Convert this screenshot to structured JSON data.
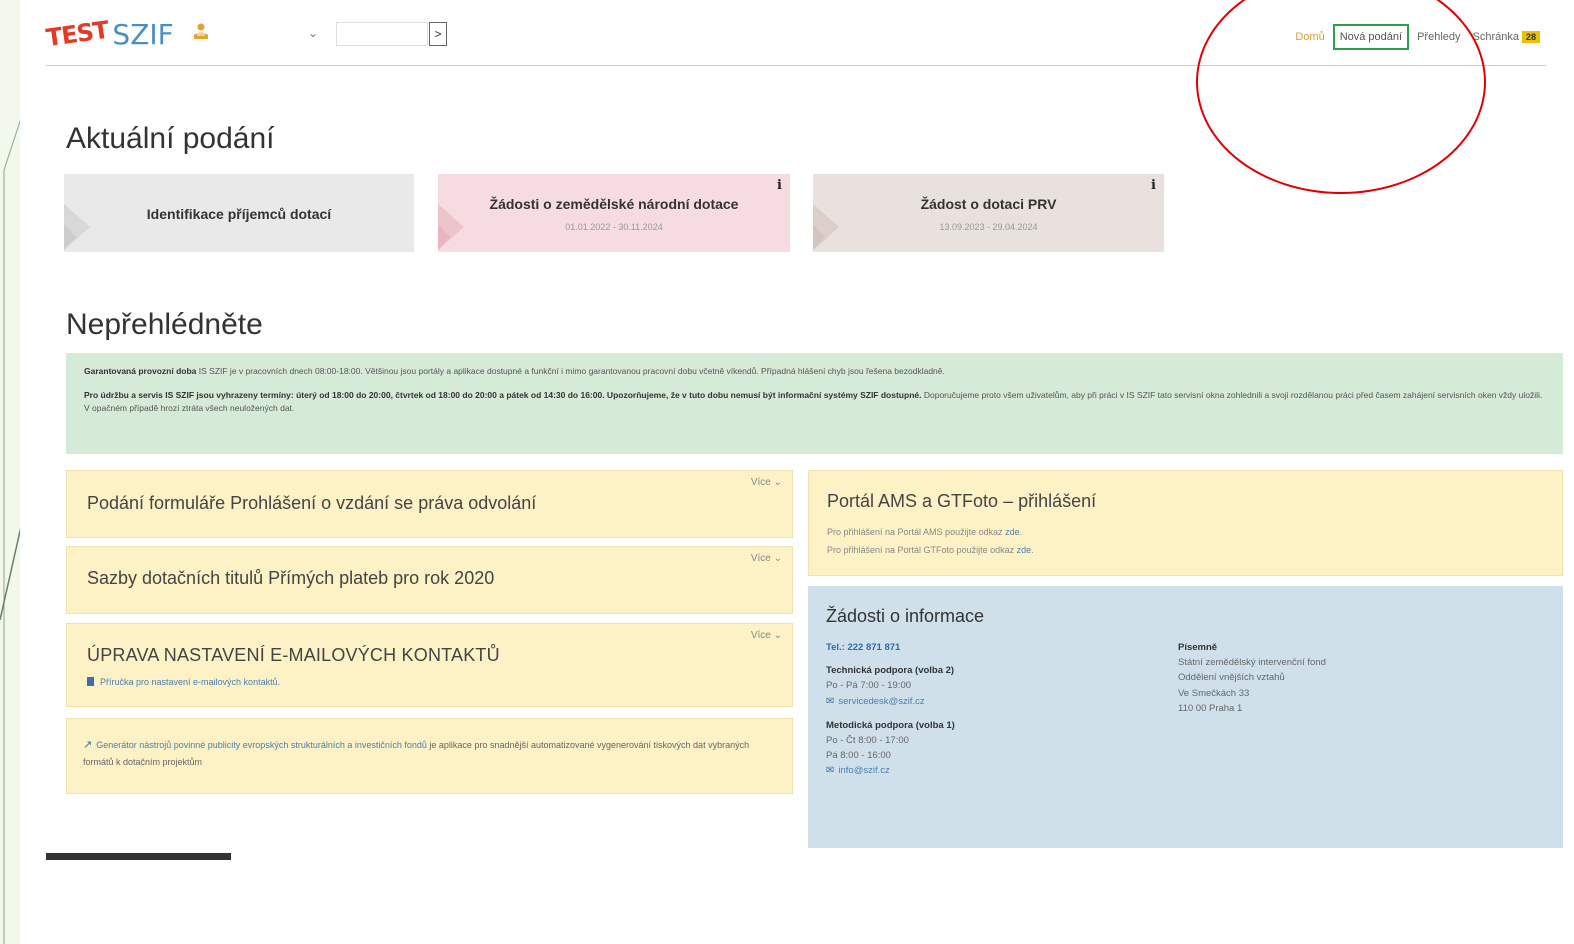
{
  "header": {
    "logo_test": "TEST",
    "logo_szif": "SZIF",
    "search_value": "",
    "go_label": ">",
    "nav": {
      "domu": "Domů",
      "nova_podani": "Nová podání",
      "prehledy": "Přehledy",
      "schranka": "Schránka",
      "schranka_badge": "28"
    }
  },
  "aktualni": {
    "title": "Aktuální podání",
    "tiles": [
      {
        "title": "Identifikace příjemců dotací",
        "subtitle": ""
      },
      {
        "title": "Žádosti o zemědělské národní dotace",
        "subtitle": "01.01.2022 - 30.11.2024"
      },
      {
        "title": "Žádost o dotaci PRV",
        "subtitle": "13.09.2023 - 29.04.2024"
      }
    ]
  },
  "neprehlednete": {
    "title": "Nepřehlédněte",
    "notice": {
      "p1_bold": "Garantovaná provozní doba",
      "p1_text": " IS SZIF je v pracovních dnech 08:00-18:00. Většinou jsou portály a aplikace dostupné a funkční i mimo garantovanou pracovní dobu včetně víkendů. Případná hlášení chyb jsou řešena bezodkladně.",
      "p2_bold": "Pro údržbu a servis IS SZIF jsou vyhrazeny termíny: úterý od 18:00 do 20:00, čtvrtek od 18:00 do 20:00 a pátek od 14:30 do 16:00. Upozorňujeme, že v tuto dobu nemusí být informační systémy SZIF dostupné.",
      "p2_text": " Doporučujeme proto všem uživatelům, aby při práci v IS SZIF tato servisní okna zohlednili a svoji rozdělanou práci před časem zahájení servisních oken vždy uložili. V opačném případě hrozí ztráta všech neuložených dat."
    },
    "vice_label": "Více",
    "box1_title": "Podání formuláře Prohlášení o vzdání se práva odvolání",
    "box2_title": "Sazby dotačních titulů Přímých plateb pro rok 2020",
    "box3_title": "ÚPRAVA NASTAVENÍ E-MAILOVÝCH KONTAKTŮ",
    "box3_link": "Příručka pro nastavení e-mailových kontaktů",
    "box3_link_suffix": ".",
    "box4_link": "Generátor nástrojů povinné publicity evropských strukturálních a investičních fondů",
    "box4_text": " je aplikace pro snadnější automatizované vygenerování tiskových dat vybraných formátů k dotačním projektům",
    "portal": {
      "title": "Portál AMS a GTFoto – přihlášení",
      "line1_text": "Pro přihlášení na Portál AMS použijte odkaz ",
      "line1_link": "zde",
      "line1_end": ".",
      "line2_text": "Pro přihlášení na Portál GTFoto použijte odkaz ",
      "line2_link": "zde",
      "line2_end": "."
    },
    "info": {
      "title": "Žádosti o informace",
      "tel": "Tel.: 222 871 871",
      "tech_title": "Technická podpora (volba 2)",
      "tech_hours": "Po - Pá 7:00 - 19:00",
      "tech_mail": "servicedesk@szif.cz",
      "met_title": "Metodická podpora (volba 1)",
      "met_hours1": "Po - Čt 8:00 - 17:00",
      "met_hours2": "Pá 8:00 - 16:00",
      "met_mail": "info@szif.cz",
      "written_title": "Písemně",
      "written_l1": "Státní zemědělský intervenční fond",
      "written_l2": "Oddělení vnějších vztahů",
      "written_l3": "Ve Smečkách 33",
      "written_l4": "110 00 Praha 1"
    }
  },
  "colors": {
    "accent_green": "#2b9e4f",
    "annotation_red": "#e00000",
    "notice_bg": "#d6ead8",
    "yellow_bg": "#fdf1c6",
    "info_bg": "#cfe0ea"
  }
}
